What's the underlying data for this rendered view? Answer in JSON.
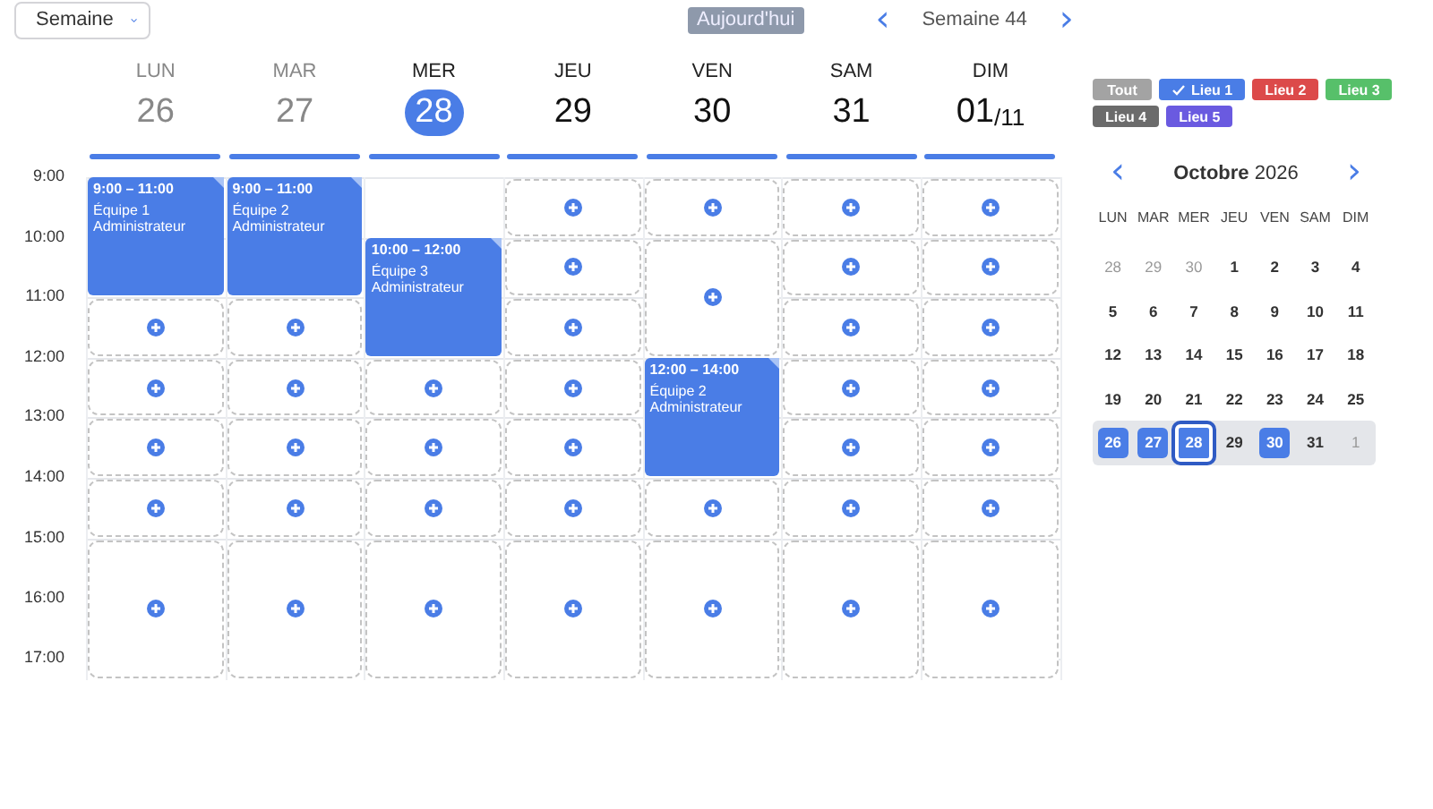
{
  "view_select": {
    "value": "Semaine"
  },
  "today_button": {
    "label": "Aujourd'hui",
    "disabled": true
  },
  "week_nav": {
    "prev": "‹",
    "label": "Semaine 44",
    "next": "›"
  },
  "hours": [
    "9:00",
    "10:00",
    "11:00",
    "12:00",
    "13:00",
    "14:00",
    "15:00",
    "16:00",
    "17:00"
  ],
  "days": [
    {
      "name": "LUN",
      "number": "26",
      "past": true,
      "selected": false,
      "items": [
        {
          "kind": "event",
          "time": "9:00 – 11:00",
          "title": "Équipe 1",
          "role": "Administrateur"
        },
        {
          "kind": "slot"
        },
        {
          "kind": "slot"
        },
        {
          "kind": "slot"
        },
        {
          "kind": "slot"
        },
        {
          "kind": "slot-long"
        }
      ]
    },
    {
      "name": "MAR",
      "number": "27",
      "past": true,
      "selected": false,
      "items": [
        {
          "kind": "event",
          "time": "9:00 – 11:00",
          "title": "Équipe 2",
          "role": "Administrateur"
        },
        {
          "kind": "slot"
        },
        {
          "kind": "slot"
        },
        {
          "kind": "slot"
        },
        {
          "kind": "slot"
        },
        {
          "kind": "slot-long"
        }
      ]
    },
    {
      "name": "MER",
      "number": "28",
      "past": false,
      "selected": true,
      "items": [
        {
          "kind": "blank"
        },
        {
          "kind": "event",
          "time": "10:00 – 12:00",
          "title": "Équipe 3",
          "role": "Administrateur"
        },
        {
          "kind": "slot"
        },
        {
          "kind": "slot"
        },
        {
          "kind": "slot"
        },
        {
          "kind": "slot-long"
        }
      ]
    },
    {
      "name": "JEU",
      "number": "29",
      "past": false,
      "selected": false,
      "items": [
        {
          "kind": "slot"
        },
        {
          "kind": "slot"
        },
        {
          "kind": "slot"
        },
        {
          "kind": "slot"
        },
        {
          "kind": "slot"
        },
        {
          "kind": "slot"
        },
        {
          "kind": "slot-long"
        }
      ]
    },
    {
      "name": "VEN",
      "number": "30",
      "past": false,
      "selected": false,
      "items": [
        {
          "kind": "slot"
        },
        {
          "kind": "slot-long"
        },
        {
          "kind": "event",
          "time": "12:00 – 14:00",
          "title": "Équipe 2",
          "role": "Administrateur"
        },
        {
          "kind": "slot"
        },
        {
          "kind": "slot-long"
        }
      ]
    },
    {
      "name": "SAM",
      "number": "31",
      "past": false,
      "selected": false,
      "items": [
        {
          "kind": "slot"
        },
        {
          "kind": "slot"
        },
        {
          "kind": "slot"
        },
        {
          "kind": "slot"
        },
        {
          "kind": "slot"
        },
        {
          "kind": "slot"
        },
        {
          "kind": "slot-long"
        }
      ]
    },
    {
      "name": "DIM",
      "number": "01",
      "month": "/11",
      "past": false,
      "selected": false,
      "items": [
        {
          "kind": "slot"
        },
        {
          "kind": "slot"
        },
        {
          "kind": "slot"
        },
        {
          "kind": "slot"
        },
        {
          "kind": "slot"
        },
        {
          "kind": "slot"
        },
        {
          "kind": "slot-long"
        }
      ]
    }
  ],
  "filters": [
    {
      "label": "Tout",
      "color": "#a3a3a3",
      "checked": false
    },
    {
      "label": "Lieu 1",
      "color": "#4a7de6",
      "checked": true
    },
    {
      "label": "Lieu 2",
      "color": "#dc4a4a",
      "checked": false
    },
    {
      "label": "Lieu 3",
      "color": "#57c06a",
      "checked": false
    },
    {
      "label": "Lieu 4",
      "color": "#6b6b6b",
      "checked": false
    },
    {
      "label": "Lieu 5",
      "color": "#6a5ae0",
      "checked": false
    }
  ],
  "mini_calendar": {
    "prev": "‹",
    "month": "Octobre",
    "year": "2026",
    "next": "›",
    "weekdays": [
      "LUN",
      "MAR",
      "MER",
      "JEU",
      "VEN",
      "SAM",
      "DIM"
    ],
    "weeks": [
      {
        "selected": false,
        "days": [
          {
            "label": "28",
            "outside": true,
            "marked": false,
            "selected": false
          },
          {
            "label": "29",
            "outside": true,
            "marked": false,
            "selected": false
          },
          {
            "label": "30",
            "outside": true,
            "marked": false,
            "selected": false
          },
          {
            "label": "1",
            "outside": false,
            "marked": false,
            "selected": false
          },
          {
            "label": "2",
            "outside": false,
            "marked": false,
            "selected": false
          },
          {
            "label": "3",
            "outside": false,
            "marked": false,
            "selected": false
          },
          {
            "label": "4",
            "outside": false,
            "marked": false,
            "selected": false
          }
        ]
      },
      {
        "selected": false,
        "days": [
          {
            "label": "5",
            "outside": false,
            "marked": false,
            "selected": false
          },
          {
            "label": "6",
            "outside": false,
            "marked": false,
            "selected": false
          },
          {
            "label": "7",
            "outside": false,
            "marked": false,
            "selected": false
          },
          {
            "label": "8",
            "outside": false,
            "marked": false,
            "selected": false
          },
          {
            "label": "9",
            "outside": false,
            "marked": false,
            "selected": false
          },
          {
            "label": "10",
            "outside": false,
            "marked": false,
            "selected": false
          },
          {
            "label": "11",
            "outside": false,
            "marked": false,
            "selected": false
          }
        ]
      },
      {
        "selected": false,
        "days": [
          {
            "label": "12",
            "outside": false,
            "marked": false,
            "selected": false
          },
          {
            "label": "13",
            "outside": false,
            "marked": false,
            "selected": false
          },
          {
            "label": "14",
            "outside": false,
            "marked": false,
            "selected": false
          },
          {
            "label": "15",
            "outside": false,
            "marked": false,
            "selected": false
          },
          {
            "label": "16",
            "outside": false,
            "marked": false,
            "selected": false
          },
          {
            "label": "17",
            "outside": false,
            "marked": false,
            "selected": false
          },
          {
            "label": "18",
            "outside": false,
            "marked": false,
            "selected": false
          }
        ]
      },
      {
        "selected": false,
        "days": [
          {
            "label": "19",
            "outside": false,
            "marked": false,
            "selected": false
          },
          {
            "label": "20",
            "outside": false,
            "marked": false,
            "selected": false
          },
          {
            "label": "21",
            "outside": false,
            "marked": false,
            "selected": false
          },
          {
            "label": "22",
            "outside": false,
            "marked": false,
            "selected": false
          },
          {
            "label": "23",
            "outside": false,
            "marked": false,
            "selected": false
          },
          {
            "label": "24",
            "outside": false,
            "marked": false,
            "selected": false
          },
          {
            "label": "25",
            "outside": false,
            "marked": false,
            "selected": false
          }
        ]
      },
      {
        "selected": true,
        "days": [
          {
            "label": "26",
            "outside": false,
            "marked": true,
            "selected": false
          },
          {
            "label": "27",
            "outside": false,
            "marked": true,
            "selected": false
          },
          {
            "label": "28",
            "outside": false,
            "marked": true,
            "selected": true
          },
          {
            "label": "29",
            "outside": false,
            "marked": false,
            "selected": false
          },
          {
            "label": "30",
            "outside": false,
            "marked": true,
            "selected": false
          },
          {
            "label": "31",
            "outside": false,
            "marked": false,
            "selected": false
          },
          {
            "label": "1",
            "outside": true,
            "marked": false,
            "selected": false
          }
        ]
      }
    ]
  }
}
